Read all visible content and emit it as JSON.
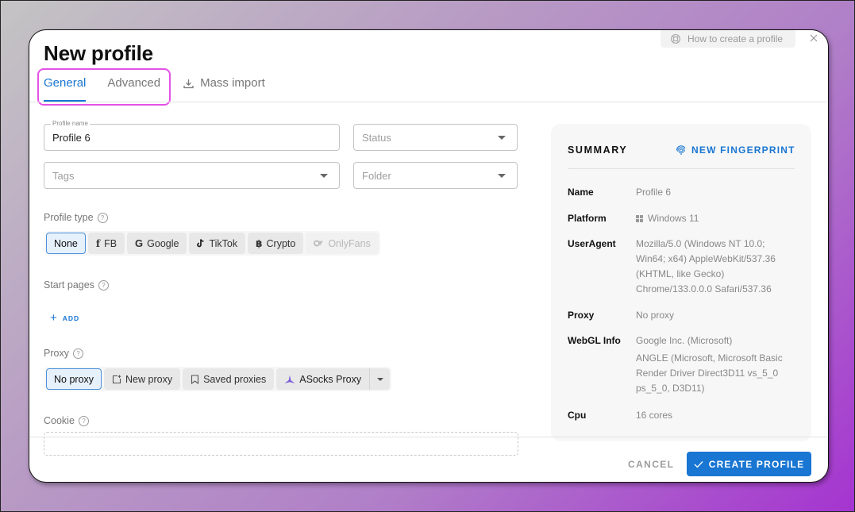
{
  "dialog": {
    "title": "New profile",
    "help_link": "How to create a profile",
    "close_icon": "close-icon"
  },
  "tabs": [
    {
      "label": "General",
      "active": true
    },
    {
      "label": "Advanced",
      "active": false
    },
    {
      "label": "Mass import",
      "active": false,
      "icon": "download-icon"
    }
  ],
  "form": {
    "profile_name": {
      "label": "Profile name",
      "value": "Profile 6"
    },
    "status": {
      "placeholder": "Status"
    },
    "tags": {
      "placeholder": "Tags"
    },
    "folder": {
      "placeholder": "Folder"
    },
    "profile_type": {
      "label": "Profile type",
      "options": [
        {
          "label": "None",
          "icon": "",
          "selected": true
        },
        {
          "label": "FB",
          "icon": "facebook-icon"
        },
        {
          "label": "Google",
          "icon": "google-icon"
        },
        {
          "label": "TikTok",
          "icon": "tiktok-icon"
        },
        {
          "label": "Crypto",
          "icon": "bitcoin-icon"
        },
        {
          "label": "OnlyFans",
          "icon": "onlyfans-icon",
          "disabled": true
        }
      ]
    },
    "start_pages": {
      "label": "Start pages",
      "add_label": "ADD"
    },
    "proxy": {
      "label": "Proxy",
      "options": [
        {
          "label": "No proxy",
          "selected": true
        },
        {
          "label": "New proxy",
          "icon": "add-window-icon"
        },
        {
          "label": "Saved proxies",
          "icon": "bookmark-icon"
        },
        {
          "label": "ASocks Proxy",
          "icon": "asocks-logo-icon"
        }
      ]
    },
    "cookie": {
      "label": "Cookie"
    }
  },
  "summary": {
    "title": "SUMMARY",
    "new_fingerprint": "NEW FINGERPRINT",
    "rows": {
      "name": {
        "key": "Name",
        "value": "Profile 6"
      },
      "platform": {
        "key": "Platform",
        "value": "Windows 11"
      },
      "useragent": {
        "key": "UserAgent",
        "lines": [
          "Mozilla/5.0 (Windows NT 10.0;",
          "Win64; x64) AppleWebKit/537.36",
          "(KHTML, like Gecko)",
          "Chrome/133.0.0.0 Safari/537.36"
        ]
      },
      "proxy": {
        "key": "Proxy",
        "value": "No proxy"
      },
      "webgl": {
        "key": "WebGL Info",
        "vendor": "Google Inc. (Microsoft)",
        "renderer_lines": [
          "ANGLE (Microsoft, Microsoft Basic",
          "Render Driver Direct3D11 vs_5_0",
          "ps_5_0, D3D11)"
        ]
      },
      "cpu": {
        "key": "Cpu",
        "value": "16 cores"
      }
    }
  },
  "footer": {
    "cancel": "CANCEL",
    "create": "CREATE PROFILE"
  },
  "colors": {
    "accent": "#1976d2",
    "highlight": "#e452e6"
  }
}
